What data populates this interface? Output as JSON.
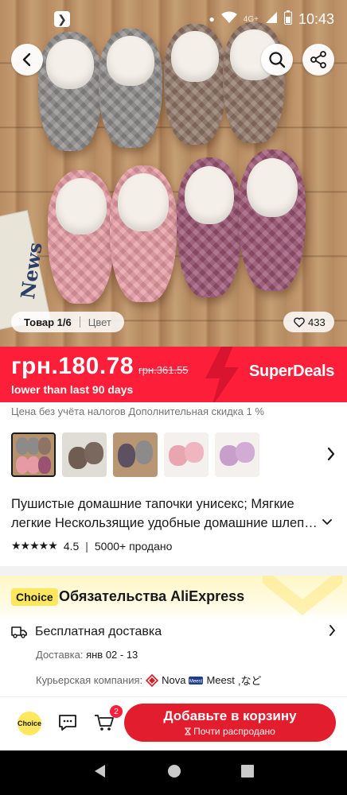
{
  "status_bar": {
    "time": "10:43",
    "network": "4G+",
    "app_badge": "❯"
  },
  "gallery": {
    "counter": "Товар 1/6",
    "color_label": "Цвет",
    "wishlist_count": "433",
    "newspaper_text": "News"
  },
  "price": {
    "current": "грн.180.78",
    "original": "грн.361.55",
    "note": "lower than last 90 days",
    "promo": "SuperDeals",
    "accent_color": "#fd1e3a"
  },
  "tax_line": "Цена без учёта налогов Дополнительная скидка 1 %",
  "product": {
    "title_line1": "Пушистые домашние тапочки унисекс; Мягкие",
    "title_line2": "легкие Нескользящие удобные домашние шлепанцы",
    "rating": "4.5",
    "sold": "5000+ продано",
    "stars": "★★★★★"
  },
  "choice": {
    "tag": "Choice",
    "title": "Обязательства AliExpress",
    "shipping": "Бесплатная доставка",
    "delivery_label": "Доставка:",
    "delivery_dates": "янв 02 - 13",
    "courier_label": "Курьерская компания:",
    "courier1": "Nova",
    "courier2": "Meest",
    "courier_suffix": ",など"
  },
  "action_bar": {
    "choice_badge": "Choice",
    "cart_count": "2",
    "add_to_cart": "Добавьте в корзину",
    "stock_note": "Почти распродано"
  }
}
